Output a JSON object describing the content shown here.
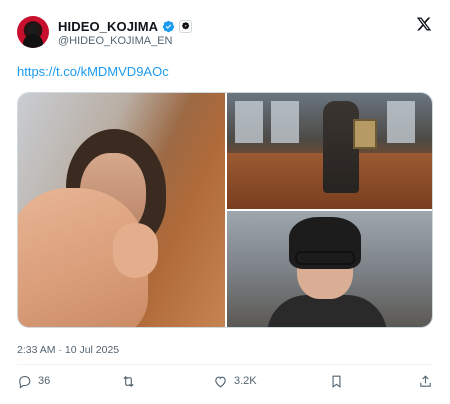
{
  "user": {
    "display_name": "HIDEO_KOJIMA",
    "handle": "@HIDEO_KOJIMA_EN",
    "affiliate_badge": "❁"
  },
  "tweet": {
    "link_text": "https://t.co/kMDMVD9AOc",
    "timestamp": "2:33 AM · 10 Jul 2025"
  },
  "actions": {
    "replies": "36",
    "retweets": "",
    "likes": "3.2K"
  },
  "colors": {
    "link": "#1d9bf0",
    "verified": "#1d9bf0",
    "muted": "#536471"
  },
  "icons": [
    "verified-badge-icon",
    "x-logo-icon",
    "reply-icon",
    "retweet-icon",
    "like-icon",
    "bookmark-icon",
    "share-icon"
  ]
}
